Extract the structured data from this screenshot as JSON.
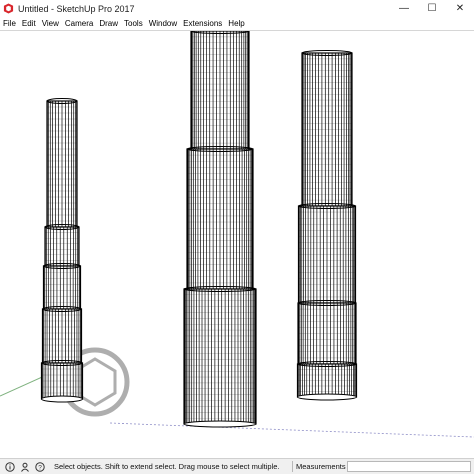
{
  "window": {
    "title": "Untitled - SketchUp Pro 2017",
    "minimize_glyph": "—",
    "maximize_glyph": "☐",
    "close_glyph": "✕"
  },
  "menu": {
    "items": [
      {
        "label": "File"
      },
      {
        "label": "Edit"
      },
      {
        "label": "View"
      },
      {
        "label": "Camera"
      },
      {
        "label": "Draw"
      },
      {
        "label": "Tools"
      },
      {
        "label": "Window"
      },
      {
        "label": "Extensions"
      },
      {
        "label": "Help"
      }
    ]
  },
  "viewport": {
    "background": "#ffffff",
    "model_stroke": "#000000",
    "axis_green": "#7fb27f",
    "axis_blue": "#9090c8",
    "logo_color": "#9a9a9a"
  },
  "status": {
    "icons": [
      "info-icon",
      "user-icon",
      "help-icon"
    ],
    "message": "Select objects. Shift to extend select. Drag mouse to select multiple.",
    "measurements_label": "Measurements",
    "measurements_value": ""
  }
}
